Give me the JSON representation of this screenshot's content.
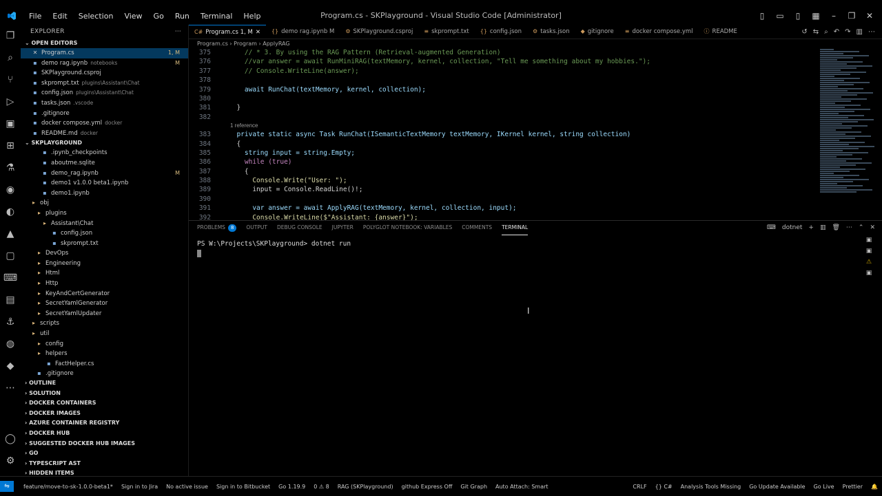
{
  "window": {
    "title": "Program.cs - SKPlayground - Visual Studio Code [Administrator]"
  },
  "menu": [
    "File",
    "Edit",
    "Selection",
    "View",
    "Go",
    "Run",
    "Terminal",
    "Help"
  ],
  "sidebar": {
    "header": "EXPLORER",
    "open_editors_label": "OPEN EDITORS",
    "open_editors": [
      {
        "name": "Program.cs",
        "desc": "",
        "badge": "1, M"
      },
      {
        "name": "demo rag.ipynb",
        "desc": "notebooks",
        "badge": "M"
      },
      {
        "name": "SKPlayground.csproj",
        "desc": "",
        "badge": ""
      },
      {
        "name": "skprompt.txt",
        "desc": "plugins\\Assistant\\Chat",
        "badge": ""
      },
      {
        "name": "config.json",
        "desc": "plugins\\Assistant\\Chat",
        "badge": ""
      },
      {
        "name": "tasks.json",
        "desc": ".vscode",
        "badge": ""
      },
      {
        "name": ".gitignore",
        "desc": "",
        "badge": ""
      },
      {
        "name": "docker compose.yml",
        "desc": "docker",
        "badge": ""
      },
      {
        "name": "README.md",
        "desc": "docker",
        "badge": ""
      }
    ],
    "workspace_label": "SKPLAYGROUND",
    "tree": [
      {
        "name": ".ipynb_checkpoints",
        "badge": ""
      },
      {
        "name": "aboutme.sqlite",
        "badge": ""
      },
      {
        "name": "demo_rag.ipynb",
        "badge": "M"
      },
      {
        "name": "demo1 v1.0.0 beta1.ipynb",
        "badge": ""
      },
      {
        "name": "demo1.ipynb",
        "badge": ""
      },
      {
        "name": "obj",
        "badge": ""
      },
      {
        "name": "plugins",
        "badge": ""
      },
      {
        "name": "Assistant\\Chat",
        "badge": ""
      },
      {
        "name": "config.json",
        "badge": ""
      },
      {
        "name": "skprompt.txt",
        "badge": ""
      },
      {
        "name": "DevOps",
        "badge": ""
      },
      {
        "name": "Engineering",
        "badge": ""
      },
      {
        "name": "Html",
        "badge": ""
      },
      {
        "name": "Http",
        "badge": ""
      },
      {
        "name": "KeyAndCertGenerator",
        "badge": ""
      },
      {
        "name": "SecretYamlGenerator",
        "badge": ""
      },
      {
        "name": "SecretYamlUpdater",
        "badge": ""
      },
      {
        "name": "scripts",
        "badge": ""
      },
      {
        "name": "util",
        "badge": ""
      },
      {
        "name": "config",
        "badge": ""
      },
      {
        "name": "helpers",
        "badge": ""
      },
      {
        "name": "FactHelper.cs",
        "badge": ""
      },
      {
        "name": ".gitignore",
        "badge": ""
      }
    ],
    "sections": [
      "OUTLINE",
      "SOLUTION",
      "DOCKER CONTAINERS",
      "DOCKER IMAGES",
      "AZURE CONTAINER REGISTRY",
      "DOCKER HUB",
      "SUGGESTED DOCKER HUB IMAGES",
      "GO",
      "TYPESCRIPT AST",
      "HIDDEN ITEMS"
    ]
  },
  "editor": {
    "tabs": [
      {
        "label": "Program.cs 1, M",
        "icon": "C#"
      },
      {
        "label": "demo rag.ipynb M",
        "icon": "{}"
      },
      {
        "label": "SKPlayground.csproj",
        "icon": "⚙"
      },
      {
        "label": "skprompt.txt",
        "icon": "≡"
      },
      {
        "label": "config.json",
        "icon": "{}"
      },
      {
        "label": "tasks.json",
        "icon": "⚙"
      },
      {
        "label": "gitignore",
        "icon": "◆"
      },
      {
        "label": "docker compose.yml",
        "icon": "≡"
      },
      {
        "label": "README",
        "icon": "ⓘ"
      }
    ],
    "breadcrumb": [
      "Program.cs",
      "Program",
      "ApplyRAG"
    ],
    "code_lines": [
      {
        "n": "375",
        "t": "    // * 3. By using the RAG Pattern (Retrieval-augmented Generation)"
      },
      {
        "n": "376",
        "t": "    //var answer = await RunMiniRAG(textMemory, kernel, collection, \"Tell me something about my hobbies.\");"
      },
      {
        "n": "377",
        "t": "    // Console.WriteLine(answer);"
      },
      {
        "n": "378",
        "t": ""
      },
      {
        "n": "379",
        "t": "    await RunChat(textMemory, kernel, collection);"
      },
      {
        "n": "380",
        "t": ""
      },
      {
        "n": "381",
        "t": "  }"
      },
      {
        "n": "382",
        "t": ""
      },
      {
        "lens": "1 reference"
      },
      {
        "n": "383",
        "t": "  private static async Task RunChat(ISemanticTextMemory textMemory, IKernel kernel, string collection)"
      },
      {
        "n": "384",
        "t": "  {"
      },
      {
        "n": "385",
        "t": "    string input = string.Empty;"
      },
      {
        "n": "386",
        "t": "    while (true)"
      },
      {
        "n": "387",
        "t": "    {"
      },
      {
        "n": "388",
        "t": "      Console.Write(\"User: \");"
      },
      {
        "n": "389",
        "t": "      input = Console.ReadLine()!;"
      },
      {
        "n": "390",
        "t": ""
      },
      {
        "n": "391",
        "t": "      var answer = await ApplyRAG(textMemory, kernel, collection, input);"
      },
      {
        "n": "392",
        "t": "      Console.WriteLine($\"Assistant: {answer}\");"
      }
    ]
  },
  "panel": {
    "tabs": [
      "PROBLEMS",
      "OUTPUT",
      "DEBUG CONSOLE",
      "JUPYTER",
      "POLYGLOT NOTEBOOK: VARIABLES",
      "COMMENTS",
      "TERMINAL"
    ],
    "problems_count": "8",
    "terminal_label": "dotnet",
    "prompt": "PS W:\\Projects\\SKPlayground>",
    "command": "dotnet run"
  },
  "status": {
    "branch": "feature/move-to-sk-1.0.0-beta1*",
    "left": [
      "Sign in to Jira",
      "No active issue",
      "Sign in to Bitbucket",
      "Go 1.19.9",
      "0 ⚠ 8",
      "RAG (SKPlayground)",
      "github Express Off",
      "Git Graph",
      "Auto Attach: Smart"
    ],
    "right": [
      "CRLF",
      "{} C#",
      "Analysis Tools Missing",
      "Go Update Available",
      "Go Live",
      "Prettier"
    ]
  }
}
